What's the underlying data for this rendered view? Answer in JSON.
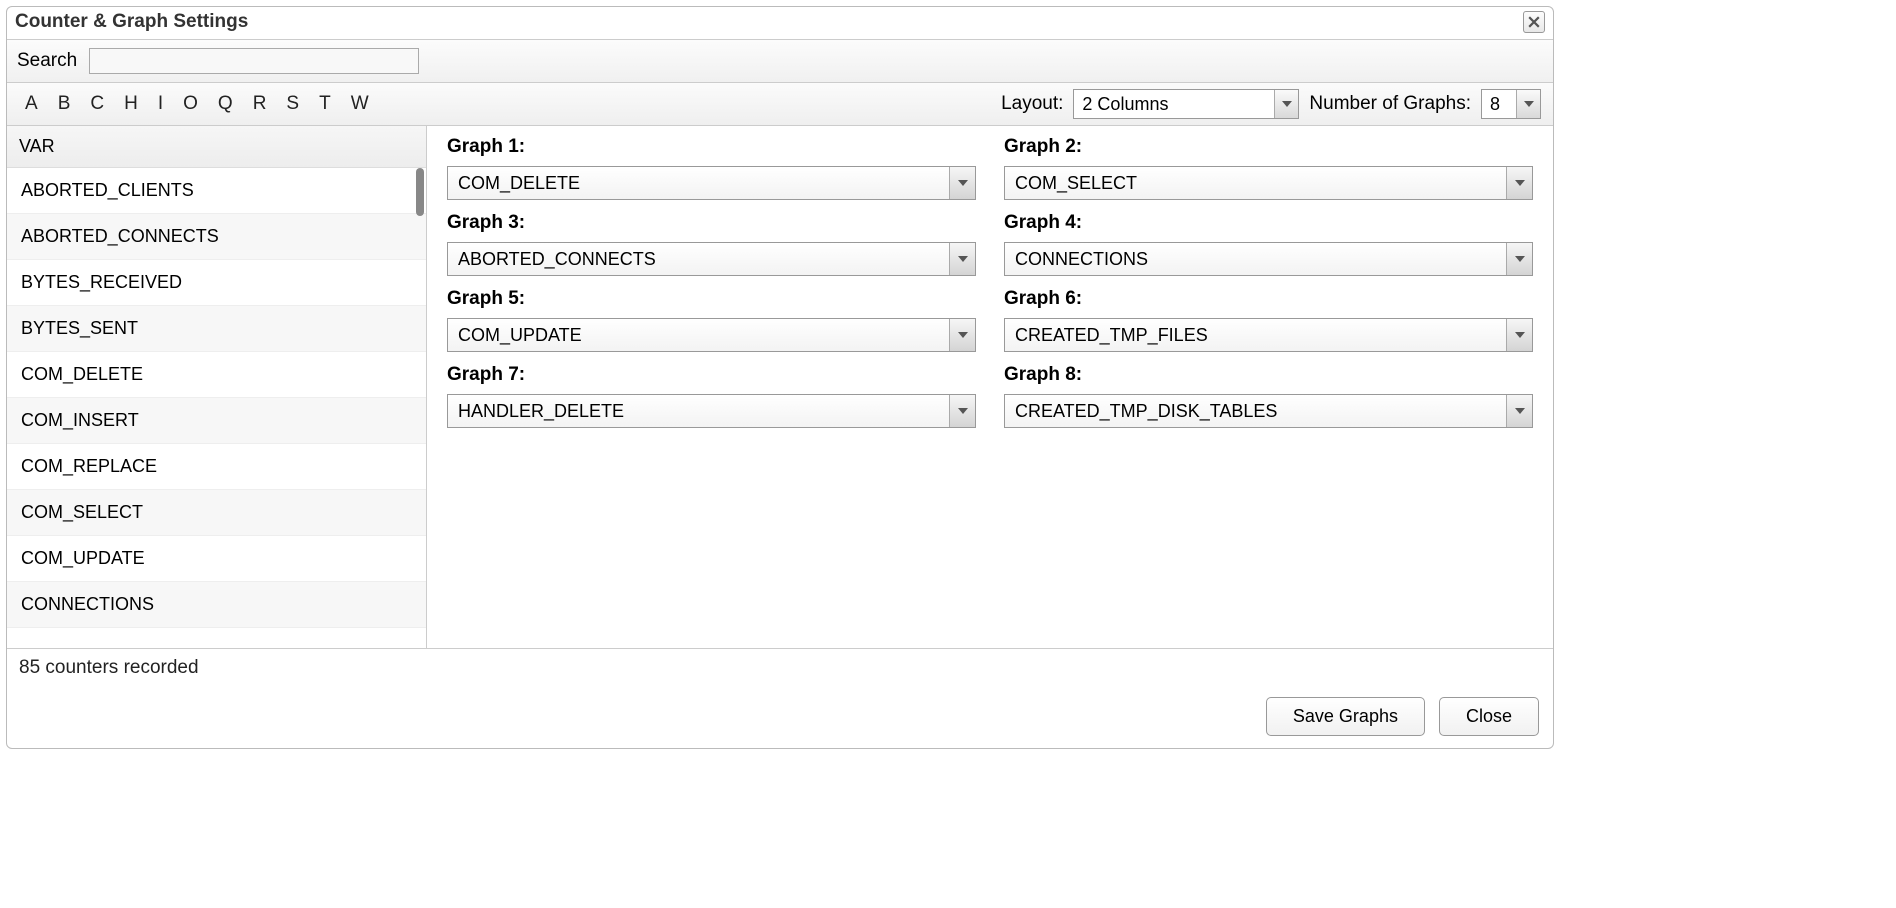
{
  "dialog": {
    "title": "Counter & Graph Settings"
  },
  "search": {
    "label": "Search",
    "value": ""
  },
  "alpha_letters": [
    "A",
    "B",
    "C",
    "H",
    "I",
    "O",
    "Q",
    "R",
    "S",
    "T",
    "W"
  ],
  "toolbar": {
    "layout_label": "Layout:",
    "layout_value": "2 Columns",
    "num_graphs_label": "Number of Graphs:",
    "num_graphs_value": "8"
  },
  "var_header": "VAR",
  "vars": [
    "ABORTED_CLIENTS",
    "ABORTED_CONNECTS",
    "BYTES_RECEIVED",
    "BYTES_SENT",
    "COM_DELETE",
    "COM_INSERT",
    "COM_REPLACE",
    "COM_SELECT",
    "COM_UPDATE",
    "CONNECTIONS"
  ],
  "graphs": [
    {
      "label": "Graph 1:",
      "value": "COM_DELETE"
    },
    {
      "label": "Graph 2:",
      "value": "COM_SELECT"
    },
    {
      "label": "Graph 3:",
      "value": "ABORTED_CONNECTS"
    },
    {
      "label": "Graph 4:",
      "value": "CONNECTIONS"
    },
    {
      "label": "Graph 5:",
      "value": "COM_UPDATE"
    },
    {
      "label": "Graph 6:",
      "value": "CREATED_TMP_FILES"
    },
    {
      "label": "Graph 7:",
      "value": "HANDLER_DELETE"
    },
    {
      "label": "Graph 8:",
      "value": "CREATED_TMP_DISK_TABLES"
    }
  ],
  "status": "85 counters recorded",
  "buttons": {
    "save": "Save Graphs",
    "close": "Close"
  }
}
